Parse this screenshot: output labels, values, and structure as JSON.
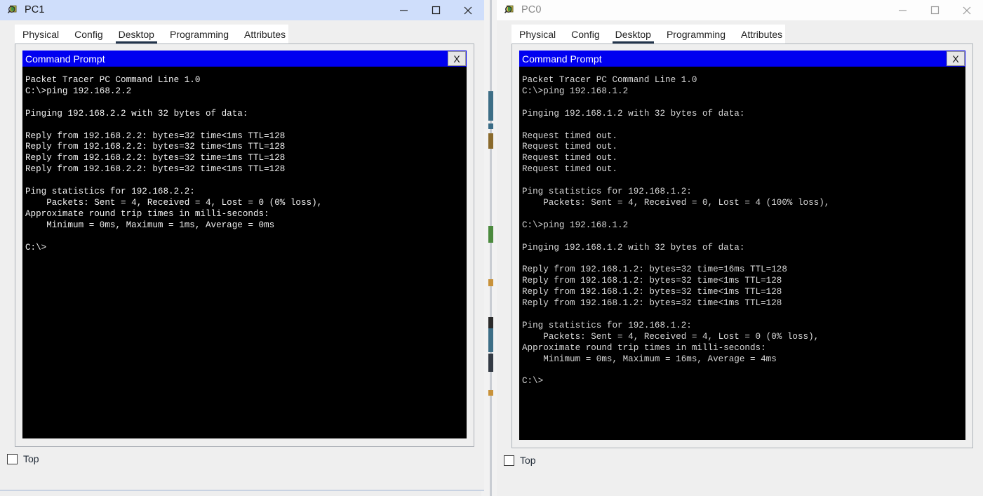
{
  "windows": [
    {
      "id": "pc1",
      "title": "PC1",
      "active": true,
      "icon": "packet-tracer-device-icon",
      "controls": {
        "minimize": "–",
        "maximize": "□",
        "close": "✕"
      },
      "tabs": [
        {
          "label": "Physical",
          "selected": false
        },
        {
          "label": "Config",
          "selected": false
        },
        {
          "label": "Desktop",
          "selected": true
        },
        {
          "label": "Programming",
          "selected": false
        },
        {
          "label": "Attributes",
          "selected": false
        }
      ],
      "command_prompt": {
        "title": "Command Prompt",
        "close_label": "X",
        "output": "Packet Tracer PC Command Line 1.0\nC:\\>ping 192.168.2.2\n\nPinging 192.168.2.2 with 32 bytes of data:\n\nReply from 192.168.2.2: bytes=32 time<1ms TTL=128\nReply from 192.168.2.2: bytes=32 time<1ms TTL=128\nReply from 192.168.2.2: bytes=32 time=1ms TTL=128\nReply from 192.168.2.2: bytes=32 time<1ms TTL=128\n\nPing statistics for 192.168.2.2:\n    Packets: Sent = 4, Received = 4, Lost = 0 (0% loss),\nApproximate round trip times in milli-seconds:\n    Minimum = 0ms, Maximum = 1ms, Average = 0ms\n\nC:\\>"
      },
      "footer": {
        "checkbox_label": "Top",
        "checked": false
      }
    },
    {
      "id": "pc0",
      "title": "PC0",
      "active": false,
      "icon": "packet-tracer-device-icon",
      "controls": {
        "minimize": "–",
        "maximize": "□",
        "close": "✕"
      },
      "tabs": [
        {
          "label": "Physical",
          "selected": false
        },
        {
          "label": "Config",
          "selected": false
        },
        {
          "label": "Desktop",
          "selected": true
        },
        {
          "label": "Programming",
          "selected": false
        },
        {
          "label": "Attributes",
          "selected": false
        }
      ],
      "command_prompt": {
        "title": "Command Prompt",
        "close_label": "X",
        "output": "Packet Tracer PC Command Line 1.0\nC:\\>ping 192.168.1.2\n\nPinging 192.168.1.2 with 32 bytes of data:\n\nRequest timed out.\nRequest timed out.\nRequest timed out.\nRequest timed out.\n\nPing statistics for 192.168.1.2:\n    Packets: Sent = 4, Received = 0, Lost = 4 (100% loss),\n\nC:\\>ping 192.168.1.2\n\nPinging 192.168.1.2 with 32 bytes of data:\n\nReply from 192.168.1.2: bytes=32 time=16ms TTL=128\nReply from 192.168.1.2: bytes=32 time<1ms TTL=128\nReply from 192.168.1.2: bytes=32 time<1ms TTL=128\nReply from 192.168.1.2: bytes=32 time<1ms TTL=128\n\nPing statistics for 192.168.1.2:\n    Packets: Sent = 4, Received = 4, Lost = 0 (0% loss),\nApproximate round trip times in milli-seconds:\n    Minimum = 0ms, Maximum = 16ms, Average = 4ms\n\nC:\\>"
      },
      "footer": {
        "checkbox_label": "Top",
        "checked": false
      }
    }
  ],
  "colors": {
    "title_active": "#cfdefb",
    "title_inactive": "#fdfdfd",
    "cmd_titlebar": "#0000f0",
    "terminal_bg": "#000000",
    "terminal_fg": "#f2f2f2",
    "tab_underline": "#22344b",
    "window_chrome": "#efefef"
  }
}
